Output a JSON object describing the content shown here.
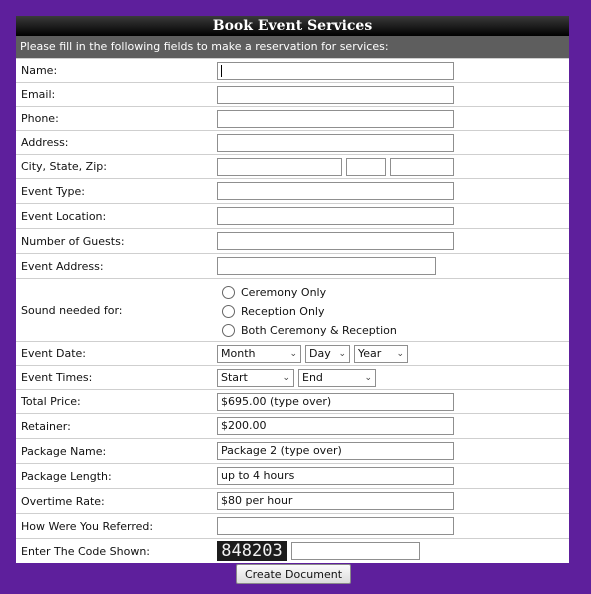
{
  "form": {
    "title": "Book Event Services",
    "subtitle": "Please fill in the following fields to make a reservation for services:"
  },
  "fields": {
    "name": {
      "label": "Name:",
      "value": ""
    },
    "email": {
      "label": "Email:",
      "value": ""
    },
    "phone": {
      "label": "Phone:",
      "value": ""
    },
    "address": {
      "label": "Address:",
      "value": ""
    },
    "city_state_zip": {
      "label": "City, State, Zip:",
      "city": "",
      "state": "",
      "zip": ""
    },
    "event_type": {
      "label": "Event Type:",
      "value": ""
    },
    "event_location": {
      "label": "Event Location:",
      "value": ""
    },
    "number_of_guests": {
      "label": "Number of Guests:",
      "value": ""
    },
    "event_address": {
      "label": "Event Address:",
      "value": ""
    },
    "sound_needed": {
      "label": "Sound needed for:",
      "options": [
        "Ceremony Only",
        "Reception Only",
        "Both Ceremony & Reception"
      ]
    },
    "event_date": {
      "label": "Event Date:",
      "month": "Month",
      "day": "Day",
      "year": "Year"
    },
    "event_times": {
      "label": "Event Times:",
      "start": "Start",
      "end": "End"
    },
    "total_price": {
      "label": "Total Price:",
      "value": "$695.00 (type over)"
    },
    "retainer": {
      "label": "Retainer:",
      "value": "$200.00"
    },
    "package_name": {
      "label": "Package Name:",
      "value": "Package 2 (type over)"
    },
    "package_length": {
      "label": "Package Length:",
      "value": "up to 4 hours"
    },
    "overtime_rate": {
      "label": "Overtime Rate:",
      "value": "$80 per hour"
    },
    "referred": {
      "label": "How Were You Referred:",
      "value": ""
    },
    "captcha": {
      "label": "Enter The Code Shown:",
      "code": "848203",
      "value": ""
    }
  },
  "submit_label": "Create Document"
}
